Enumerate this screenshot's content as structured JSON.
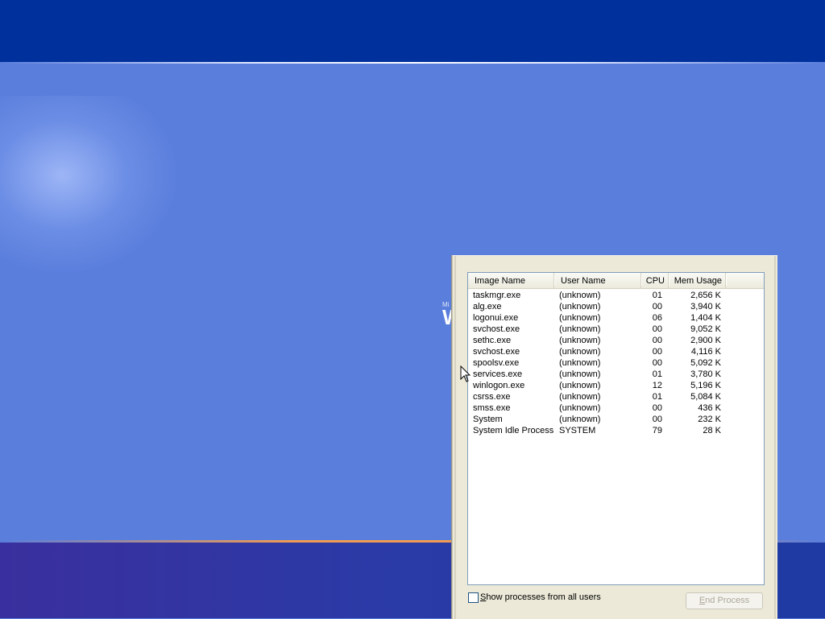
{
  "desktop": {
    "logo_small": "Mi",
    "logo_big": "W"
  },
  "task_manager": {
    "columns": {
      "image_name": "Image Name",
      "user_name": "User Name",
      "cpu": "CPU",
      "mem_usage": "Mem Usage"
    },
    "processes": [
      {
        "image": "taskmgr.exe",
        "user": "(unknown)",
        "cpu": "01",
        "mem": "2,656 K"
      },
      {
        "image": "alg.exe",
        "user": "(unknown)",
        "cpu": "00",
        "mem": "3,940 K"
      },
      {
        "image": "logonui.exe",
        "user": "(unknown)",
        "cpu": "06",
        "mem": "1,404 K"
      },
      {
        "image": "svchost.exe",
        "user": "(unknown)",
        "cpu": "00",
        "mem": "9,052 K"
      },
      {
        "image": "sethc.exe",
        "user": "(unknown)",
        "cpu": "00",
        "mem": "2,900 K"
      },
      {
        "image": "svchost.exe",
        "user": "(unknown)",
        "cpu": "00",
        "mem": "4,116 K"
      },
      {
        "image": "spoolsv.exe",
        "user": "(unknown)",
        "cpu": "00",
        "mem": "5,092 K"
      },
      {
        "image": "services.exe",
        "user": "(unknown)",
        "cpu": "01",
        "mem": "3,780 K"
      },
      {
        "image": "winlogon.exe",
        "user": "(unknown)",
        "cpu": "12",
        "mem": "5,196 K"
      },
      {
        "image": "csrss.exe",
        "user": "(unknown)",
        "cpu": "01",
        "mem": "5,084 K"
      },
      {
        "image": "smss.exe",
        "user": "(unknown)",
        "cpu": "00",
        "mem": "436 K"
      },
      {
        "image": "System",
        "user": "(unknown)",
        "cpu": "00",
        "mem": "232 K"
      },
      {
        "image": "System Idle Process",
        "user": "SYSTEM",
        "cpu": "79",
        "mem": "28 K"
      }
    ],
    "show_all_prefix": "S",
    "show_all_rest": "how processes from all users",
    "show_all_checked": false,
    "end_process_prefix": "E",
    "end_process_rest": "nd Process"
  },
  "colors": {
    "desktop_blue": "#5a7edc",
    "top_band": "#00309c",
    "accent_orange": "#f09a52",
    "list_border": "#7f9db9"
  },
  "icons": {
    "cursor": "arrow-cursor-icon"
  }
}
